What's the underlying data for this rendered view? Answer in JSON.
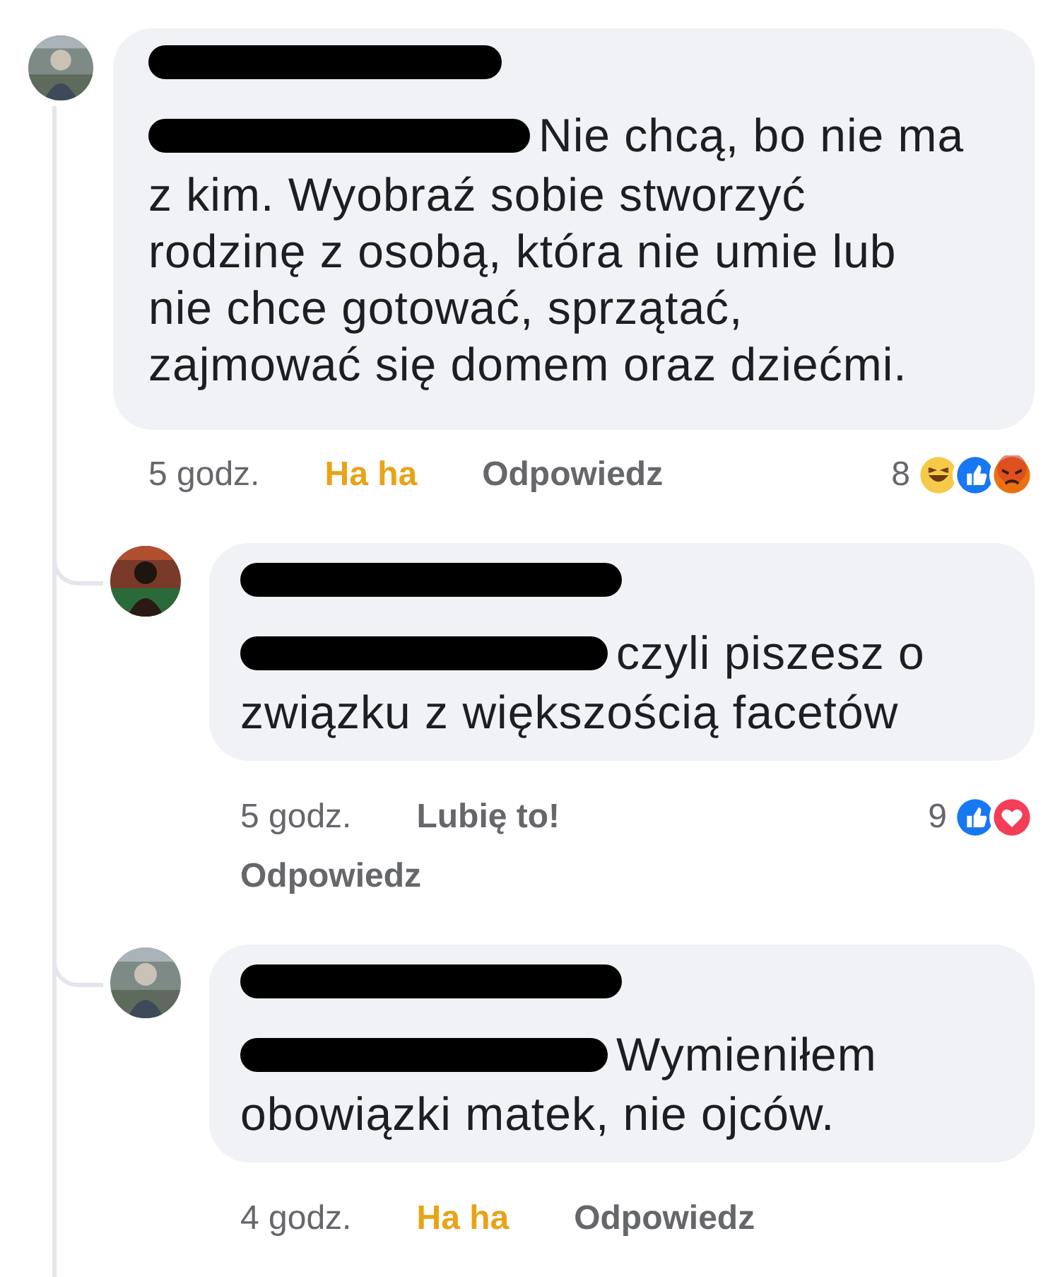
{
  "comments": [
    {
      "first_line": "Nie chcą, bo nie ma",
      "text": "z kim. Wyobraź sobie stworzyć rodzinę z osobą, która nie umie lub nie chce gotować, sprzątać, zajmować się domem oraz dziećmi.",
      "time": "5 godz.",
      "action": {
        "label": "Ha ha",
        "active": true
      },
      "reply": "Odpowiedz",
      "reaction_count": "8",
      "reactions": [
        {
          "kind": "haha"
        },
        {
          "kind": "like"
        },
        {
          "kind": "angry"
        }
      ],
      "replies": [
        {
          "first_line": "czyli piszesz o",
          "text": "związku z większością facetów",
          "time": "5 godz.",
          "action": {
            "label": "Lubię to!",
            "active": false
          },
          "reply": "Odpowiedz",
          "reaction_count": "9",
          "reactions": [
            {
              "kind": "like"
            },
            {
              "kind": "love"
            }
          ]
        },
        {
          "first_line": "Wymieniłem",
          "text": "obowiązki matek, nie ojców.",
          "time": "4 godz.",
          "action": {
            "label": "Ha ha",
            "active": true
          },
          "reply": "Odpowiedz"
        }
      ]
    }
  ]
}
